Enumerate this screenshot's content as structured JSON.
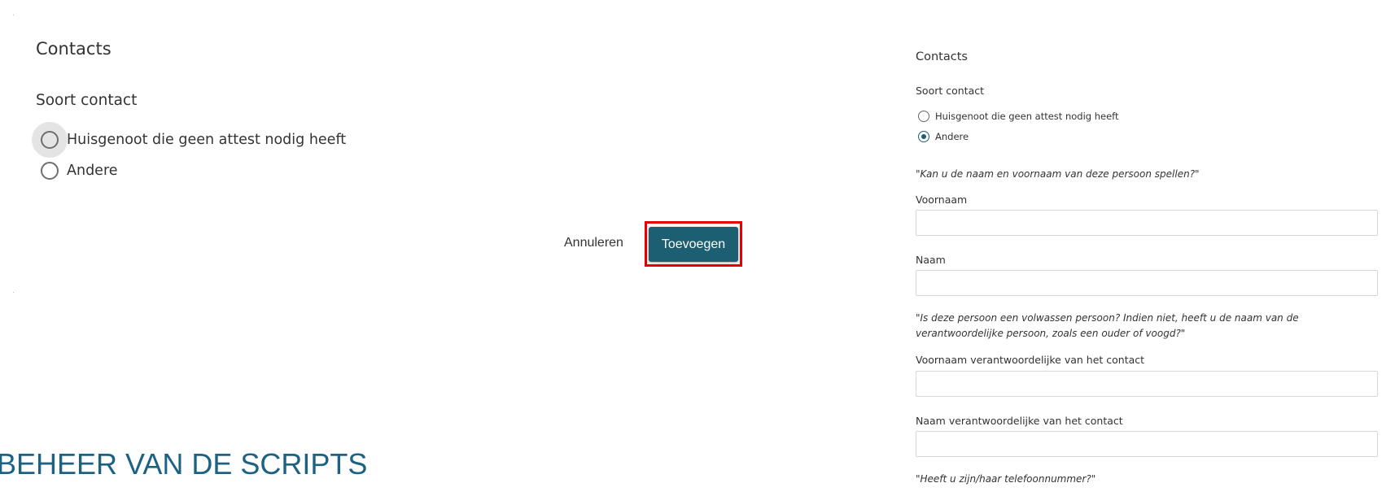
{
  "left_dialog": {
    "title": "Contacts",
    "section_label": "Soort contact",
    "options": [
      {
        "label": "Huisgenoot die geen attest nodig heeft",
        "selected": false,
        "hovered": true
      },
      {
        "label": "Andere",
        "selected": false,
        "hovered": false
      }
    ],
    "cancel_label": "Annuleren",
    "add_label": "Toevoegen",
    "add_highlight_color": "#e60000",
    "add_button_color": "#1d5f72"
  },
  "section_heading": "BEHEER VAN DE SCRIPTS",
  "right_form": {
    "title": "Contacts",
    "section_label": "Soort contact",
    "options": [
      {
        "label": "Huisgenoot die geen attest nodig heeft",
        "selected": false
      },
      {
        "label": "Andere",
        "selected": true
      }
    ],
    "quote_name": "\"Kan u de naam en voornaam van deze persoon spellen?\"",
    "fields": {
      "voornaam": {
        "label": "Voornaam",
        "value": ""
      },
      "naam": {
        "label": "Naam",
        "value": ""
      },
      "voornaam_verantwoordelijke": {
        "label": "Voornaam verantwoordelijke van het contact",
        "value": ""
      },
      "naam_verantwoordelijke": {
        "label": "Naam verantwoordelijke van het contact",
        "value": ""
      }
    },
    "quote_adult": "\"Is deze persoon een volwassen persoon? Indien niet, heeft u de naam van de verantwoordelijke persoon, zoals een ouder of voogd?\"",
    "quote_phone": "\"Heeft u zijn/haar telefoonnummer?\""
  }
}
